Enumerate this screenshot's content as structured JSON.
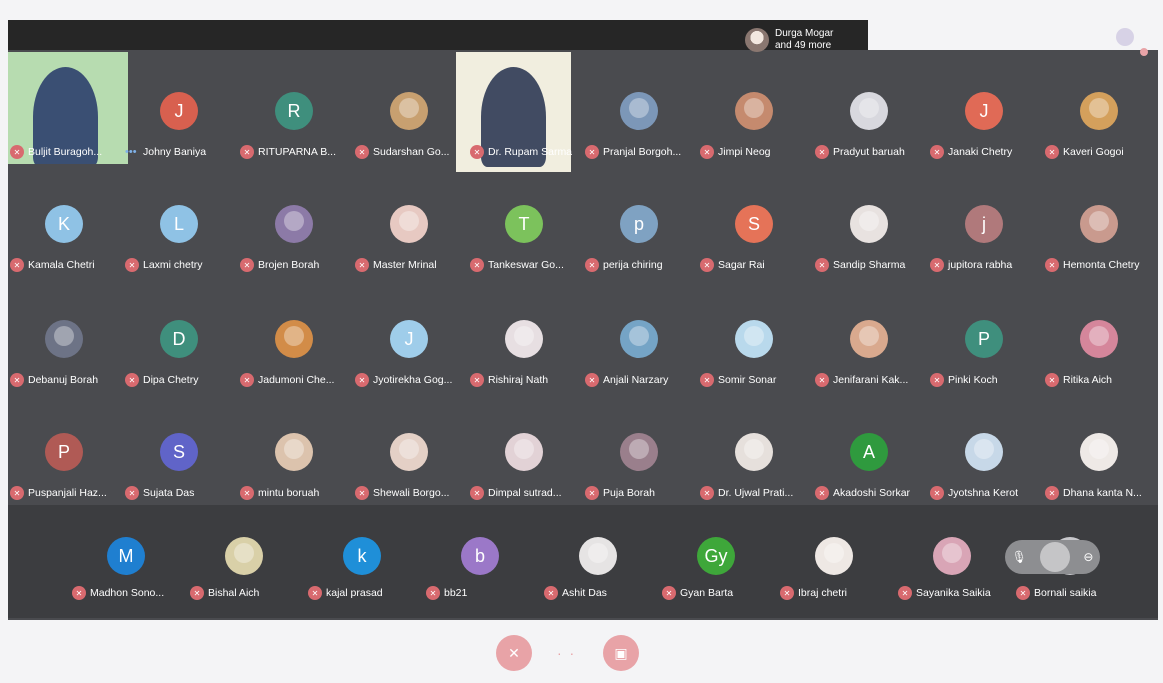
{
  "others": {
    "name": "Durga Mogar",
    "more": "and 49 more"
  },
  "colors": {
    "mic_muted": "#d86a6f",
    "control_red": "#e8a3a7",
    "tile_bg": "#4a4b4f",
    "strip_bg": "#3c3d40"
  },
  "participants_rows": [
    [
      {
        "name": "Buljit Buragoh...",
        "type": "video"
      },
      {
        "name": "Johny Baniya",
        "initial": "J",
        "color": "#d8604f",
        "speaking": true
      },
      {
        "name": "RITUPARNA B...",
        "initial": "R",
        "color": "#3f8f7d"
      },
      {
        "name": "Sudarshan Go...",
        "photo": true,
        "color": "#c8a070"
      },
      {
        "name": "Dr. Rupam Sarma",
        "type": "video"
      },
      {
        "name": "Pranjal Borgoh...",
        "photo": true,
        "color": "#7c97b8"
      },
      {
        "name": "Jimpi Neog",
        "photo": true,
        "color": "#c58a6e"
      },
      {
        "name": "Pradyut baruah",
        "photo": true,
        "color": "#d8d8de"
      },
      {
        "name": "Janaki Chetry",
        "initial": "J",
        "color": "#e06a56"
      },
      {
        "name": "Kaveri Gogoi",
        "photo": true,
        "color": "#d4a05c"
      }
    ],
    [
      {
        "name": "Kamala Chetri",
        "initial": "K",
        "color": "#8fc2e5"
      },
      {
        "name": "Laxmi chetry",
        "initial": "L",
        "color": "#8fc2e5"
      },
      {
        "name": "Brojen Borah",
        "photo": true,
        "color": "#8c7aa7"
      },
      {
        "name": "Master Mrinal",
        "photo": true,
        "color": "#e7c9c2"
      },
      {
        "name": "Tankeswar Go...",
        "initial": "T",
        "color": "#7cc25c"
      },
      {
        "name": "perija chiring",
        "initial": "p",
        "color": "#7fa2c2"
      },
      {
        "name": "Sagar Rai",
        "initial": "S",
        "color": "#e57358"
      },
      {
        "name": "Sandip Sharma",
        "photo": true,
        "color": "#e8e2e0"
      },
      {
        "name": "jupitora rabha",
        "initial": "j",
        "color": "#b0797b"
      },
      {
        "name": "Hemonta Chetry",
        "photo": true,
        "color": "#c99a8e"
      }
    ],
    [
      {
        "name": "Debanuj Borah",
        "photo": true,
        "color": "#6d7386"
      },
      {
        "name": "Dipa Chetry",
        "initial": "D",
        "color": "#3f8f7d"
      },
      {
        "name": "Jadumoni Che...",
        "photo": true,
        "color": "#d28c48"
      },
      {
        "name": "Jyotirekha Gog...",
        "initial": "J",
        "color": "#9fcdea"
      },
      {
        "name": "Rishiraj Nath",
        "photo": true,
        "color": "#e7dfe2"
      },
      {
        "name": "Anjali Narzary",
        "photo": true,
        "color": "#75a4c6"
      },
      {
        "name": "Somir Sonar",
        "photo": true,
        "color": "#b9d9ec"
      },
      {
        "name": "Jenifarani Kak...",
        "photo": true,
        "color": "#d9a98e"
      },
      {
        "name": "Pinki Koch",
        "initial": "P",
        "color": "#3f8f7d"
      },
      {
        "name": "Ritika Aich",
        "photo": true,
        "color": "#d5869b"
      }
    ],
    [
      {
        "name": "Puspanjali Haz...",
        "initial": "P",
        "color": "#b05a55"
      },
      {
        "name": "Sujata Das",
        "initial": "S",
        "color": "#6064c8"
      },
      {
        "name": "mintu boruah",
        "photo": true,
        "color": "#dcc3ad"
      },
      {
        "name": "Shewali Borgo...",
        "photo": true,
        "color": "#e4d0c6"
      },
      {
        "name": "Dimpal sutrad...",
        "photo": true,
        "color": "#e2d2d6"
      },
      {
        "name": "Puja Borah",
        "photo": true,
        "color": "#9a7f8c"
      },
      {
        "name": "Dr. Ujwal Prati...",
        "photo": true,
        "color": "#e6e0dc"
      },
      {
        "name": "Akadoshi Sorkar",
        "initial": "A",
        "color": "#2f9a3e"
      },
      {
        "name": "Jyotshna Kerot",
        "photo": true,
        "color": "#c7d8e8"
      },
      {
        "name": "Dhana kanta N...",
        "photo": true,
        "color": "#eee9e6"
      }
    ]
  ],
  "strip": [
    {
      "name": "Madhon Sono...",
      "initial": "M",
      "color": "#1f7fd0"
    },
    {
      "name": "Bishal Aich",
      "photo": true,
      "color": "#d9d0a8"
    },
    {
      "name": "kajal prasad",
      "initial": "k",
      "color": "#1f8fd8"
    },
    {
      "name": "bb21",
      "initial": "b",
      "color": "#9b78c8"
    },
    {
      "name": "Ashit Das",
      "photo": true,
      "color": "#e6e4e4"
    },
    {
      "name": "Gyan Barta",
      "initial": "Gy",
      "color": "#3ea73a"
    },
    {
      "name": "Ibraj chetri",
      "photo": true,
      "color": "#eee8e4"
    },
    {
      "name": "Sayanika Saikia",
      "photo": true,
      "color": "#d9a5b6"
    },
    {
      "name": "Bornali saikia",
      "photo": true,
      "color": "#c8c8cc"
    }
  ],
  "controls": {
    "mic_icon": "mic-off-icon",
    "cam_icon": "camera-off-icon",
    "more": "· ·"
  }
}
